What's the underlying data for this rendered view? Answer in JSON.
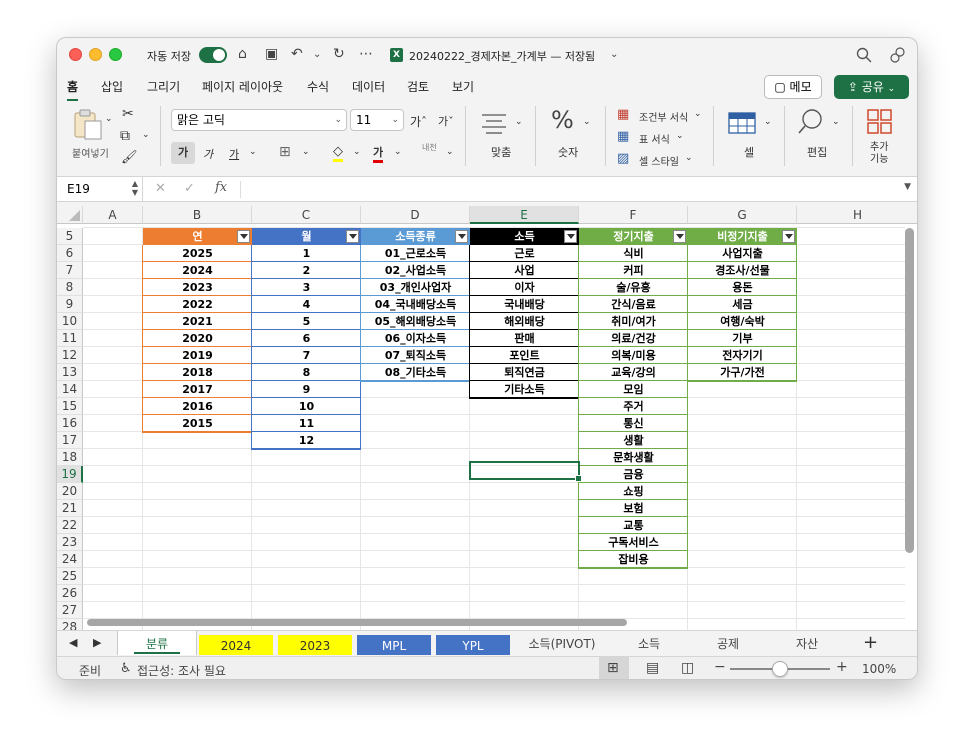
{
  "titlebar": {
    "autosave_label": "자동 저장",
    "doc_title": "20240222_경제자본_가계부 — 저장됨"
  },
  "ribbon_tabs": [
    "홈",
    "삽입",
    "그리기",
    "페이지 레이아웃",
    "수식",
    "데이터",
    "검토",
    "보기"
  ],
  "buttons": {
    "memo": "메모",
    "share": "공유"
  },
  "ribbon": {
    "paste": "붙여넣기",
    "font_name": "맑은 고딕",
    "font_size": "11",
    "bold": "가",
    "italic": "가",
    "underline": "가",
    "font_color": "가",
    "align": "맞춤",
    "number": "숫자",
    "cond_format": "조건부 서식",
    "table_format": "표 서식",
    "cell_style": "셀 스타일",
    "cells": "셀",
    "edit": "편집",
    "addins": "추가\n기능",
    "phonetic": "내천"
  },
  "formula_bar": {
    "name_box": "E19",
    "formula": ""
  },
  "columns": [
    "A",
    "B",
    "C",
    "D",
    "E",
    "F",
    "G",
    "H"
  ],
  "rows": [
    "5",
    "6",
    "7",
    "8",
    "9",
    "10",
    "11",
    "12",
    "13",
    "14",
    "15",
    "16",
    "17",
    "18",
    "19",
    "20",
    "21",
    "22",
    "23",
    "24",
    "25",
    "26",
    "27",
    "28"
  ],
  "tables": {
    "year": {
      "header": "연",
      "color": "#ED7D31",
      "values": [
        "2025",
        "2024",
        "2023",
        "2022",
        "2021",
        "2020",
        "2019",
        "2018",
        "2017",
        "2016",
        "2015"
      ]
    },
    "month": {
      "header": "월",
      "color": "#4472C4",
      "values": [
        "1",
        "2",
        "3",
        "4",
        "5",
        "6",
        "7",
        "8",
        "9",
        "10",
        "11",
        "12"
      ]
    },
    "income_type": {
      "header": "소득종류",
      "color": "#5B9BD5",
      "values": [
        "01_근로소득",
        "02_사업소득",
        "03_개인사업자",
        "04_국내배당소득",
        "05_해외배당소득",
        "06_이자소득",
        "07_퇴직소득",
        "08_기타소득"
      ]
    },
    "income": {
      "header": "소득",
      "color": "#000000",
      "values": [
        "근로",
        "사업",
        "이자",
        "국내배당",
        "해외배당",
        "판매",
        "포인트",
        "퇴직연금",
        "기타소득"
      ]
    },
    "regular_expense": {
      "header": "정기지출",
      "color": "#70AD47",
      "values": [
        "식비",
        "커피",
        "술/유흥",
        "간식/음료",
        "취미/여가",
        "의료/건강",
        "의복/미용",
        "교육/강의",
        "모임",
        "주거",
        "통신",
        "생활",
        "문화생활",
        "금융",
        "쇼핑",
        "보험",
        "교통",
        "구독서비스",
        "잡비용"
      ]
    },
    "irregular_expense": {
      "header": "비정기지출",
      "color": "#70AD47",
      "values": [
        "사업지출",
        "경조사/선물",
        "용돈",
        "세금",
        "여행/숙박",
        "기부",
        "전자기기",
        "가구/가전"
      ]
    }
  },
  "sheet_tabs": [
    {
      "label": "분류",
      "active": true,
      "color": ""
    },
    {
      "label": "2024",
      "color": "#FFFF00"
    },
    {
      "label": "2023",
      "color": "#FFFF00"
    },
    {
      "label": "MPL",
      "color": "#4472C4"
    },
    {
      "label": "YPL",
      "color": "#4472C4"
    },
    {
      "label": "소득(PIVOT)",
      "color": ""
    },
    {
      "label": "소득",
      "color": ""
    },
    {
      "label": "공제",
      "color": ""
    },
    {
      "label": "자산",
      "color": ""
    }
  ],
  "status": {
    "ready": "준비",
    "accessibility": "접근성: 조사 필요",
    "zoom": "100%"
  }
}
